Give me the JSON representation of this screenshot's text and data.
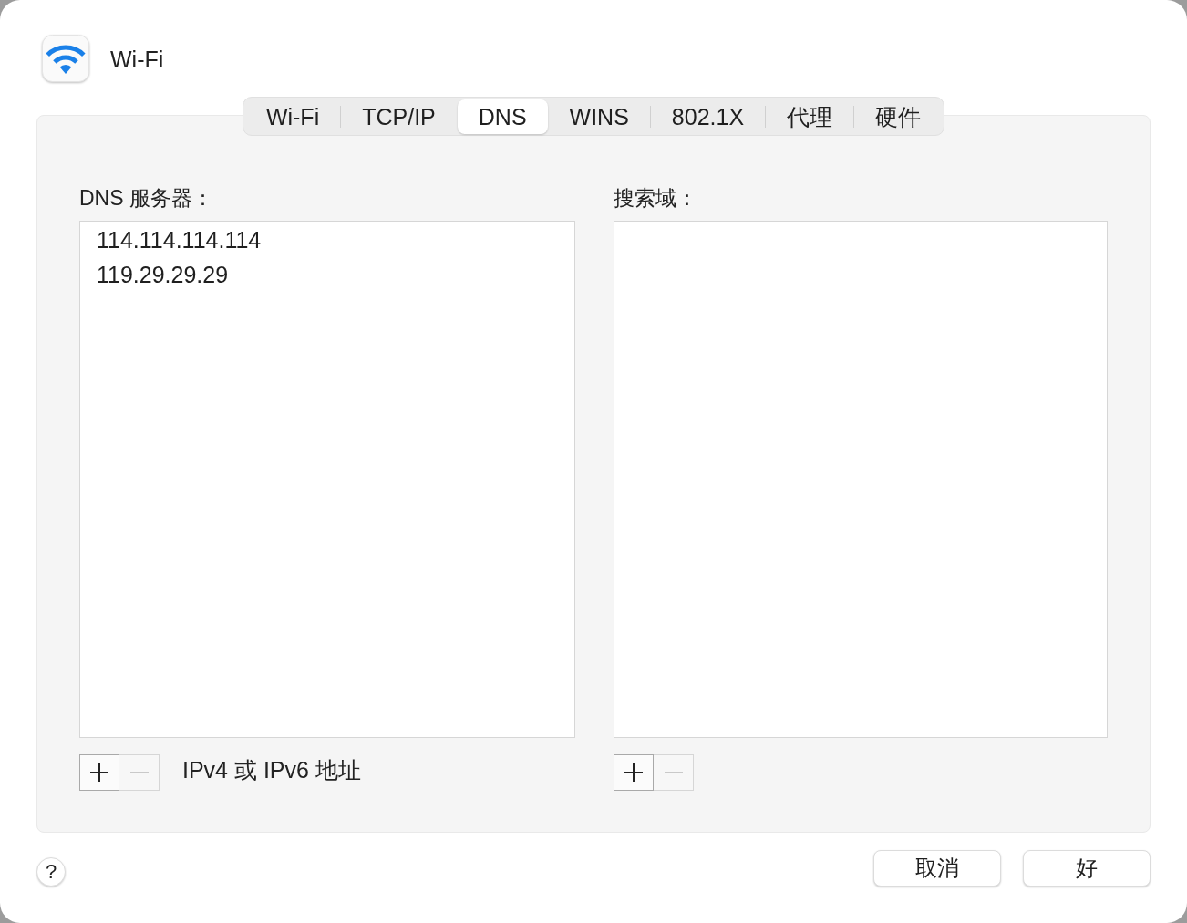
{
  "window": {
    "title": "Wi-Fi"
  },
  "tabs": [
    {
      "label": "Wi-Fi",
      "selected": false
    },
    {
      "label": "TCP/IP",
      "selected": false
    },
    {
      "label": "DNS",
      "selected": true
    },
    {
      "label": "WINS",
      "selected": false
    },
    {
      "label": "802.1X",
      "selected": false
    },
    {
      "label": "代理",
      "selected": false
    },
    {
      "label": "硬件",
      "selected": false
    }
  ],
  "dns_servers": {
    "label": "DNS 服务器：",
    "entries": [
      {
        "text": "114.114.114.114",
        "selected": false
      },
      {
        "text": "119.29.29.29",
        "selected": false
      }
    ],
    "add_button": {
      "disabled": false
    },
    "remove_button": {
      "disabled": true
    },
    "hint": "IPv4 或 IPv6 地址"
  },
  "search_domains": {
    "label": "搜索域：",
    "add_button": {
      "disabled": false
    },
    "remove_button": {
      "disabled": true
    }
  },
  "help_button": {
    "label": "?"
  },
  "buttons": [
    {
      "label": "取消"
    },
    {
      "label": "好"
    }
  ]
}
